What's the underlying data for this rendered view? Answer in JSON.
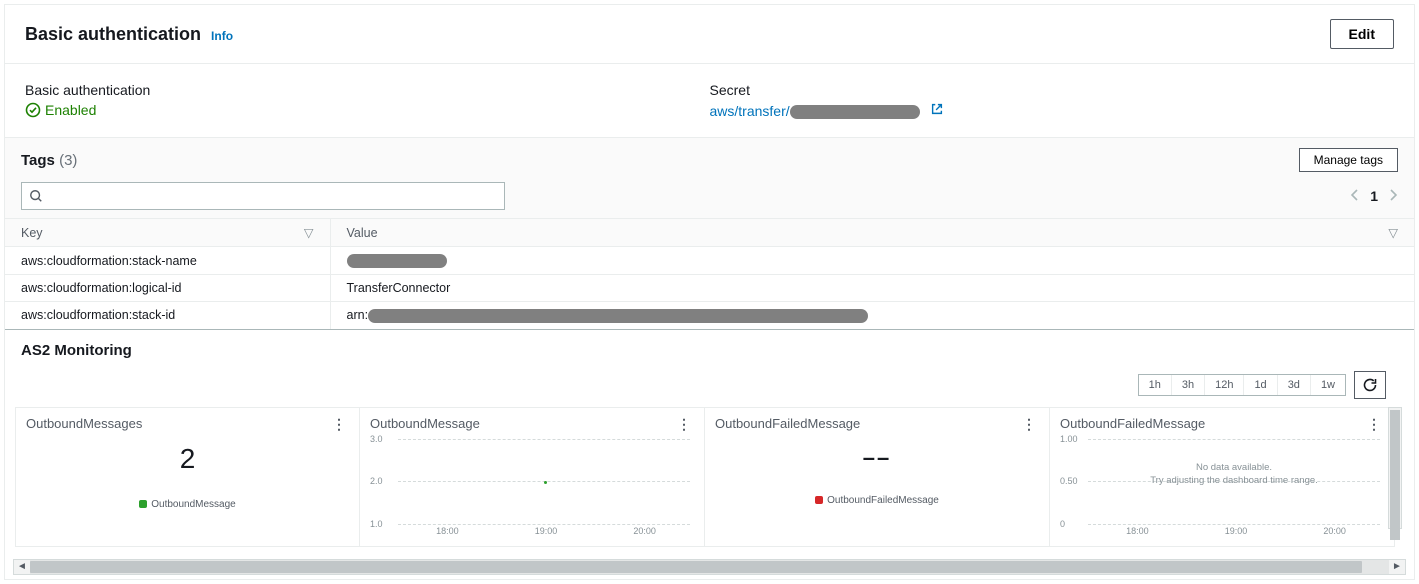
{
  "auth_panel": {
    "title": "Basic authentication",
    "info_label": "Info",
    "edit_label": "Edit",
    "fields": {
      "auth_label": "Basic authentication",
      "auth_status": "Enabled",
      "secret_label": "Secret",
      "secret_link_prefix": "aws/transfer/"
    }
  },
  "tags": {
    "title": "Tags",
    "count": "(3)",
    "manage_label": "Manage tags",
    "page_current": "1",
    "columns": {
      "key": "Key",
      "value": "Value"
    },
    "rows": [
      {
        "key": "aws:cloudformation:stack-name",
        "value_prefix": "",
        "redacted": "long"
      },
      {
        "key": "aws:cloudformation:logical-id",
        "value_prefix": "TransferConnector",
        "redacted": ""
      },
      {
        "key": "aws:cloudformation:stack-id",
        "value_prefix": "arn:",
        "redacted": "xlong"
      }
    ]
  },
  "monitoring": {
    "title": "AS2 Monitoring",
    "ranges": [
      "1h",
      "3h",
      "12h",
      "1d",
      "3d",
      "1w"
    ],
    "charts": [
      {
        "title": "OutboundMessages",
        "type": "number",
        "value": "2",
        "legend": "OutboundMessage",
        "legend_color": "green"
      },
      {
        "title": "OutboundMessage",
        "type": "line",
        "y_ticks": [
          "3.0",
          "2.0",
          "1.0"
        ],
        "x_ticks": [
          "18:00",
          "19:00",
          "20:00"
        ],
        "point": true
      },
      {
        "title": "OutboundFailedMessage",
        "type": "number",
        "value": "––",
        "legend": "OutboundFailedMessage",
        "legend_color": "red"
      },
      {
        "title": "OutboundFailedMessage",
        "type": "line",
        "y_ticks": [
          "1.00",
          "0.50",
          "0"
        ],
        "x_ticks": [
          "18:00",
          "19:00",
          "20:00"
        ],
        "no_data_l1": "No data available.",
        "no_data_l2": "Try adjusting the dashboard time range."
      }
    ]
  },
  "chart_data": [
    {
      "type": "bar",
      "title": "OutboundMessages",
      "categories": [
        "OutboundMessage"
      ],
      "values": [
        2
      ]
    },
    {
      "type": "line",
      "title": "OutboundMessage",
      "x": [
        "18:00",
        "19:00",
        "20:00"
      ],
      "series": [
        {
          "name": "OutboundMessage",
          "values": [
            null,
            2,
            null
          ]
        }
      ],
      "ylim": [
        1.0,
        3.0
      ],
      "ylabel": "",
      "xlabel": ""
    },
    {
      "type": "bar",
      "title": "OutboundFailedMessage",
      "categories": [
        "OutboundFailedMessage"
      ],
      "values": [
        null
      ]
    },
    {
      "type": "line",
      "title": "OutboundFailedMessage",
      "x": [
        "18:00",
        "19:00",
        "20:00"
      ],
      "series": [
        {
          "name": "OutboundFailedMessage",
          "values": [
            null,
            null,
            null
          ]
        }
      ],
      "ylim": [
        0,
        1.0
      ],
      "ylabel": "",
      "xlabel": "",
      "annotations": [
        "No data available.",
        "Try adjusting the dashboard time range."
      ]
    }
  ]
}
